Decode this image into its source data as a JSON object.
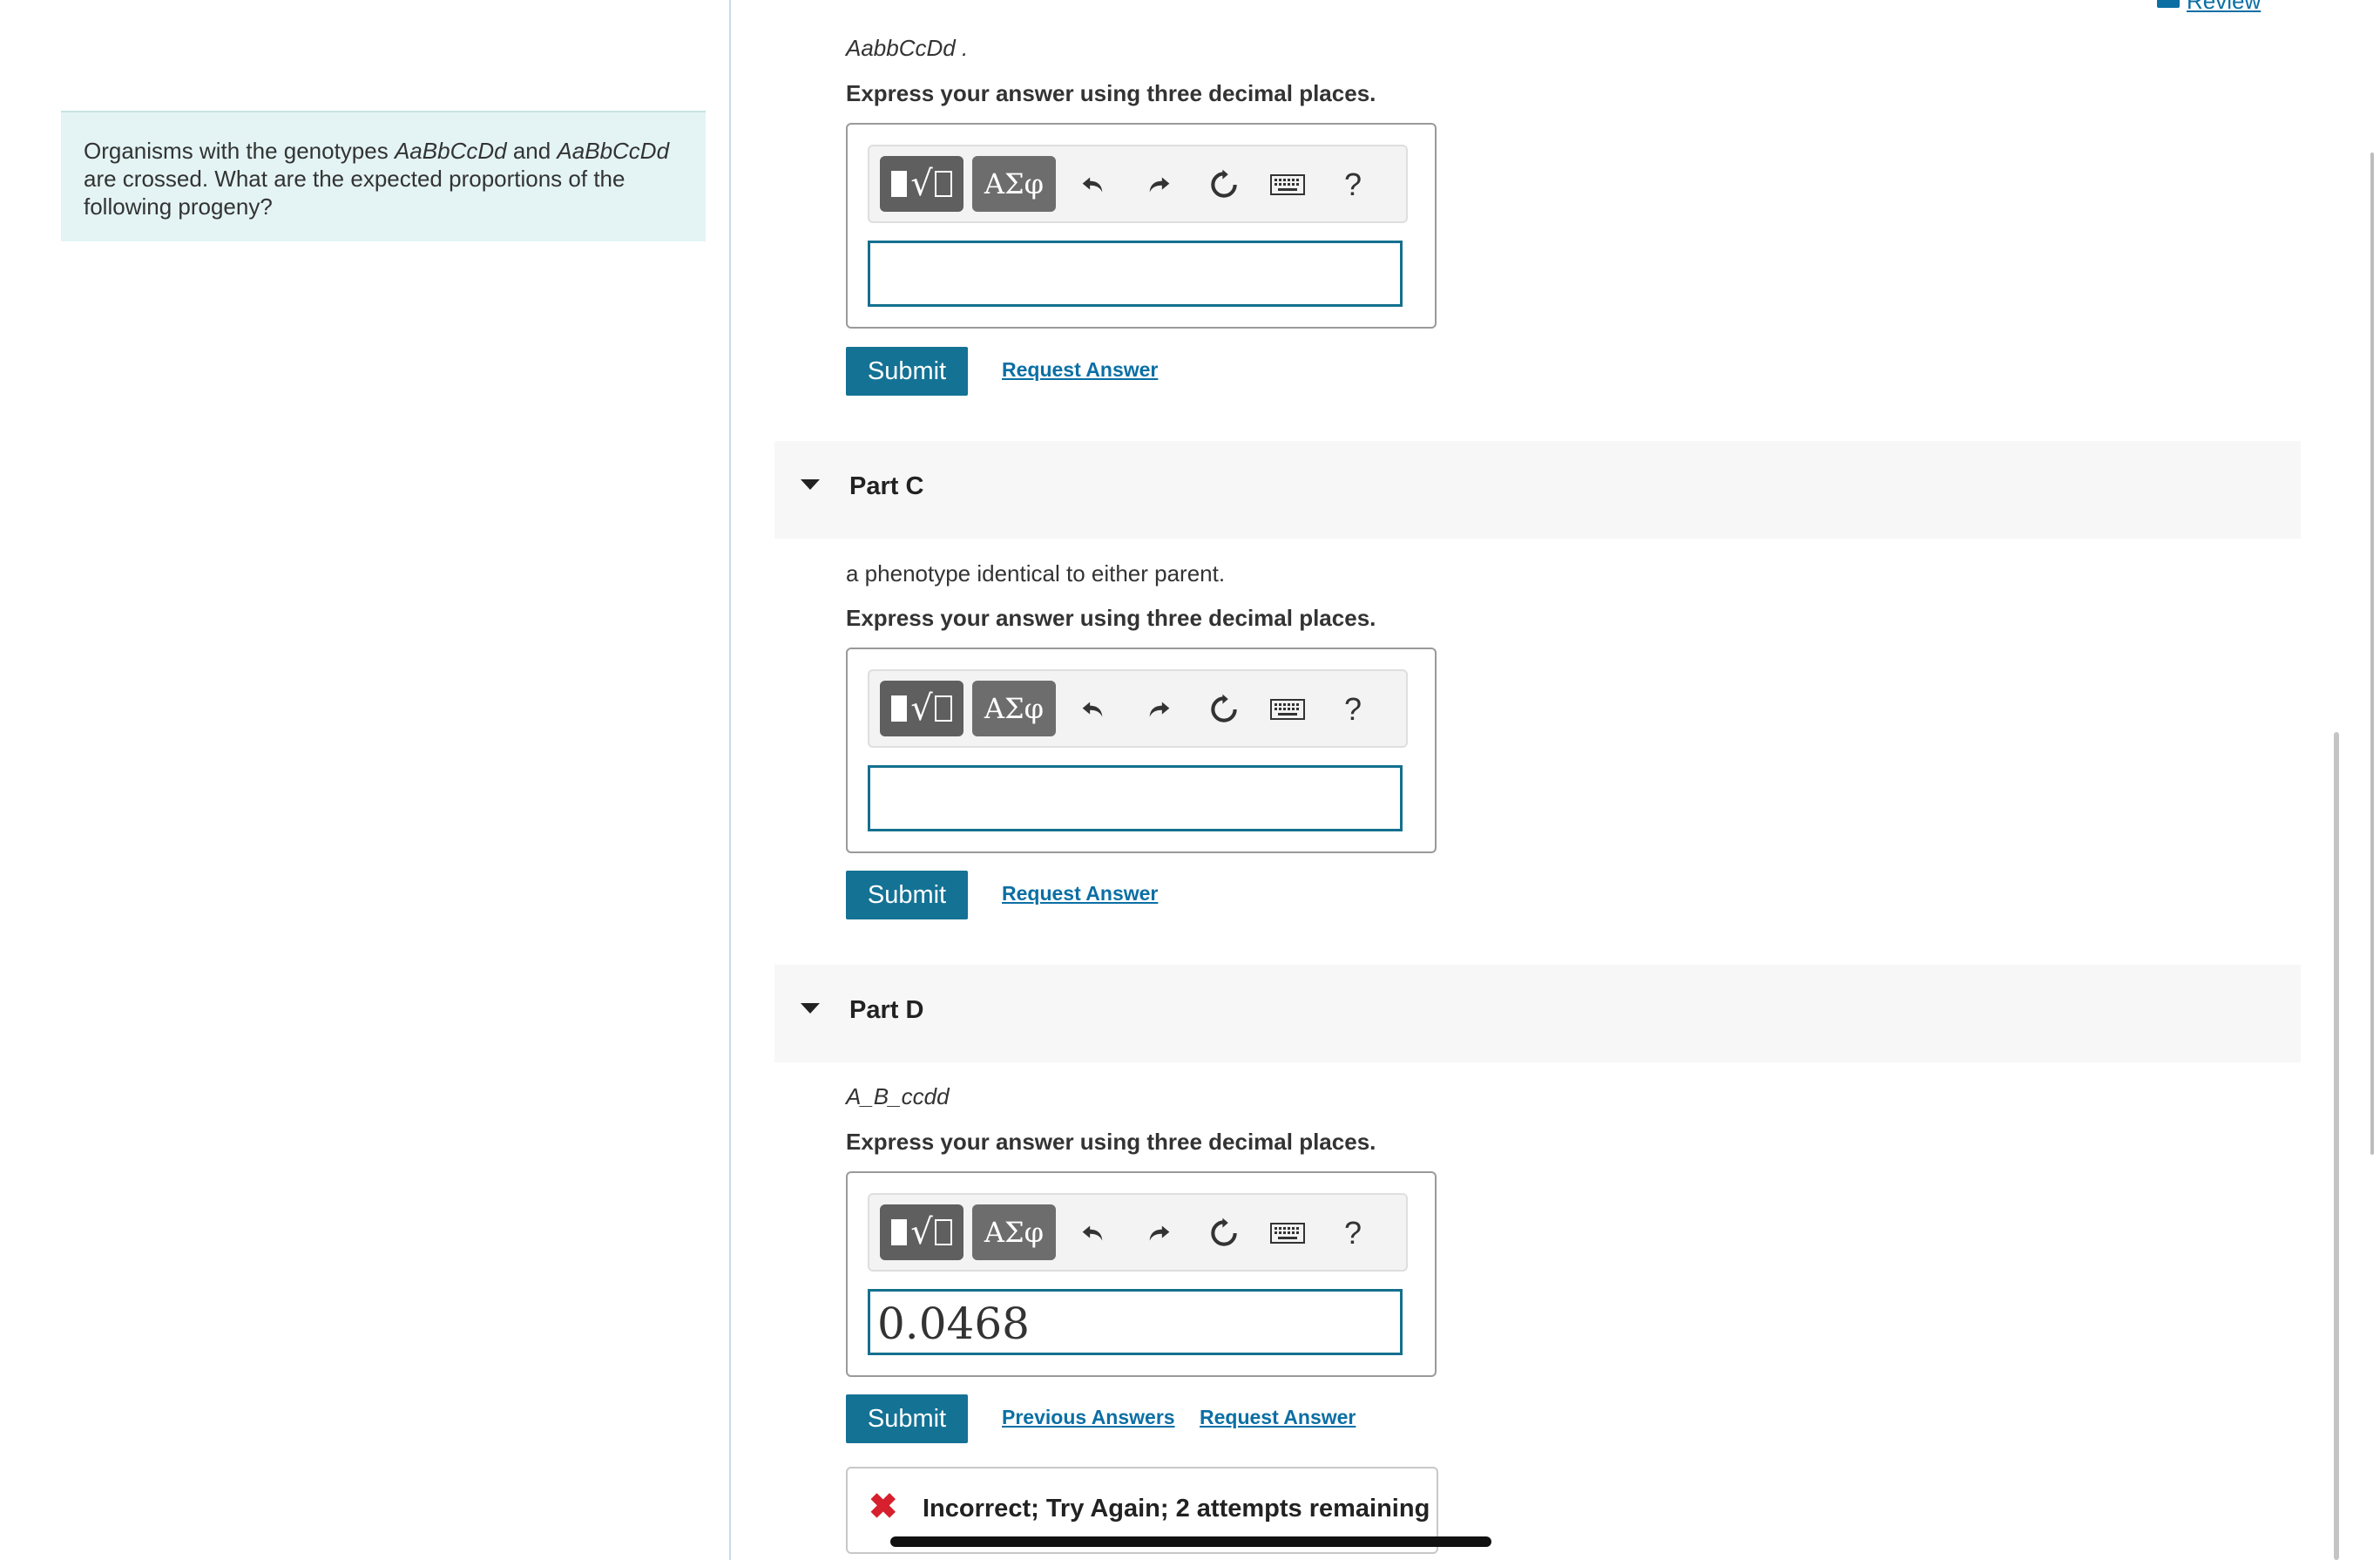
{
  "problem": {
    "text_1": "Organisms with the genotypes ",
    "genotype_1": "AaBbCcDd",
    "text_2": " and ",
    "genotype_2": "AaBbCcDd",
    "text_3": " are crossed. What are the expected proportions of the following progeny?"
  },
  "header": {
    "review_label": "Review"
  },
  "toolbar": {
    "greek_label": "ΑΣφ",
    "help_label": "?",
    "icons": [
      "templates-icon",
      "greek-symbols-icon",
      "undo-icon",
      "redo-icon",
      "reset-icon",
      "keyboard-icon",
      "help-icon"
    ]
  },
  "part_b": {
    "prompt": "AabbCcDd .",
    "instruction": "Express your answer using three decimal places.",
    "answer_value": "",
    "submit_label": "Submit",
    "request_label": "Request Answer"
  },
  "part_c": {
    "title": "Part C",
    "prompt": "a phenotype identical to either parent.",
    "instruction": "Express your answer using three decimal places.",
    "answer_value": "",
    "submit_label": "Submit",
    "request_label": "Request Answer"
  },
  "part_d": {
    "title": "Part D",
    "prompt": "A_B_ccdd",
    "instruction": "Express your answer using three decimal places.",
    "answer_value": "0.0468",
    "submit_label": "Submit",
    "previous_label": "Previous Answers",
    "request_label": "Request Answer",
    "feedback": "Incorrect; Try Again; 2 attempts remaining",
    "feedback_icon": "x-icon"
  },
  "colors": {
    "accent": "#147295",
    "link": "#0b6fa4",
    "problem_bg": "#e4f4f4",
    "error": "#d6202d"
  }
}
